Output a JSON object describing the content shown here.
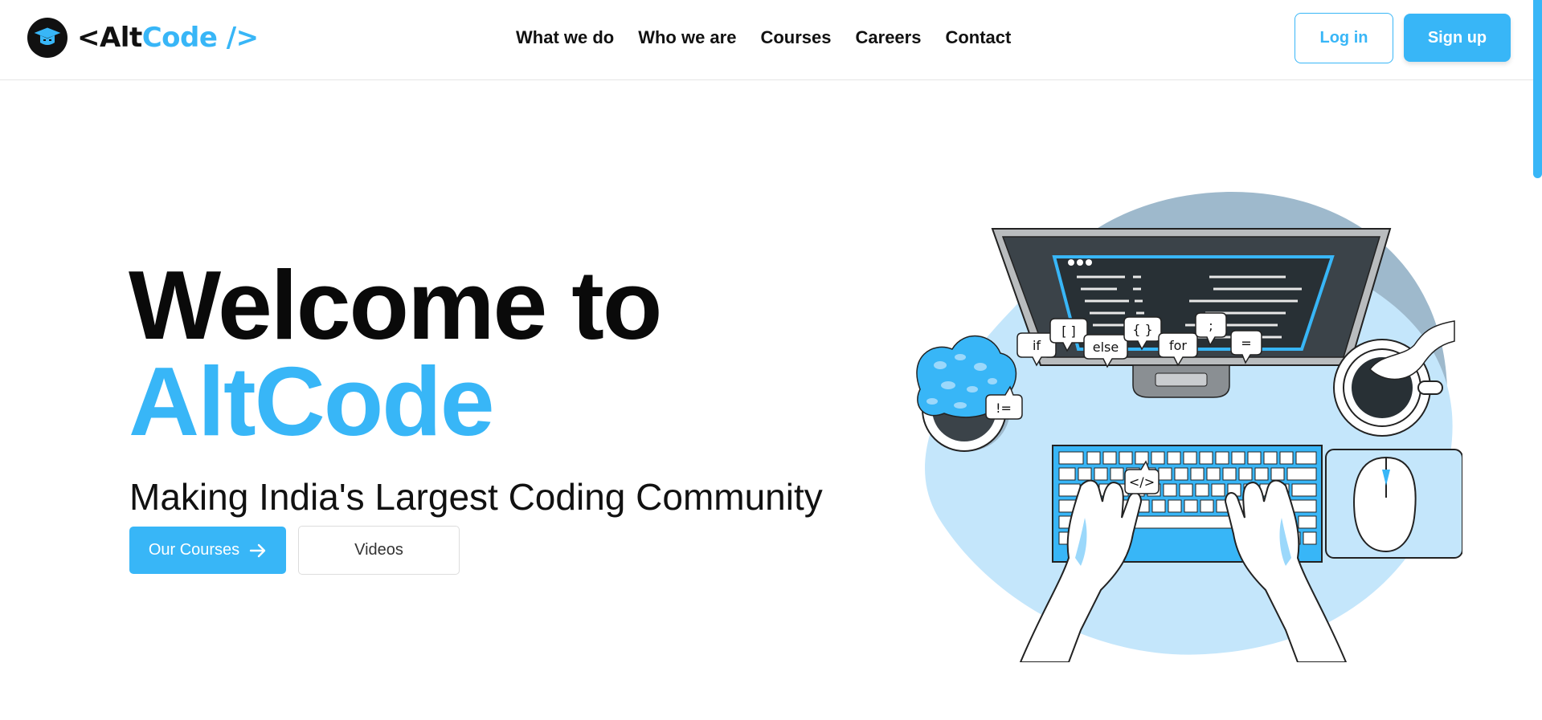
{
  "brand": {
    "name_prefix": "<Alt",
    "name_highlight": "Code />",
    "logo_icon": "graduation-cap-icon"
  },
  "nav": {
    "links": [
      "What we do",
      "Who we are",
      "Courses",
      "Careers",
      "Contact"
    ]
  },
  "auth": {
    "login_label": "Log in",
    "signup_label": "Sign up"
  },
  "hero": {
    "title_line1": "Welcome to",
    "title_line2": "AltCode",
    "subtitle": "Making India's Largest Coding Community",
    "primary_button": "Our Courses",
    "primary_button_icon": "arrow-right-icon",
    "secondary_button": "Videos"
  },
  "illustration": {
    "code_bubbles": [
      "if",
      "[ ]",
      "else",
      "{ }",
      "for",
      ";",
      "=",
      "!=",
      "</>"
    ]
  },
  "colors": {
    "accent": "#38b6f7",
    "text": "#111111",
    "blob": "#c4e6fb",
    "blob_shadow": "#9eb9cc"
  }
}
